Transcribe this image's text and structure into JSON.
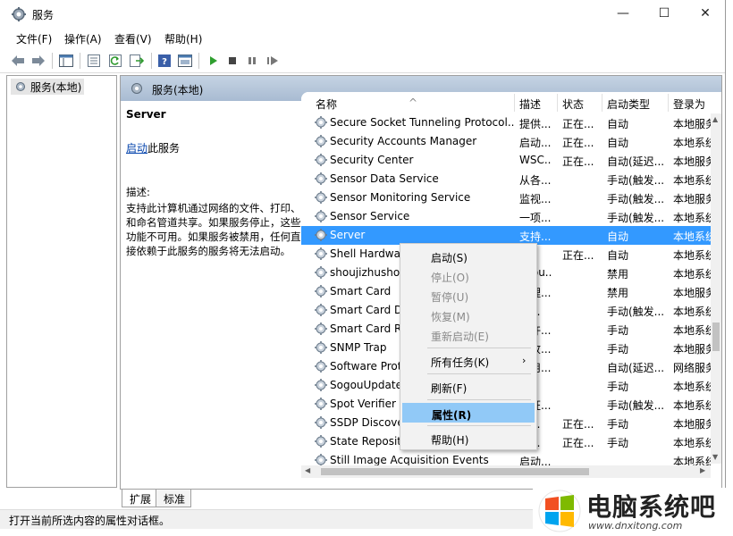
{
  "window": {
    "title": "服务",
    "minimize": "—",
    "maximize": "☐",
    "close": "✕"
  },
  "menu": [
    {
      "label": "文件(F)"
    },
    {
      "label": "操作(A)"
    },
    {
      "label": "查看(V)"
    },
    {
      "label": "帮助(H)"
    }
  ],
  "toolbar": {
    "icons": [
      "back-icon",
      "forward-icon",
      "show-tree-icon",
      "properties-icon",
      "refresh-icon",
      "export-icon",
      "help-icon",
      "console-icon",
      "start-icon",
      "stop-icon",
      "pause-icon",
      "restart-icon"
    ]
  },
  "tree": {
    "root_label": "服务(本地)"
  },
  "pane_header": {
    "title": "服务(本地)"
  },
  "description": {
    "service_name": "Server",
    "start_link": "启动",
    "start_suffix": "此服务",
    "label": "描述:",
    "text": "支持此计算机通过网络的文件、打印、和命名管道共享。如果服务停止，这些功能不可用。如果服务被禁用，任何直接依赖于此服务的服务将无法启动。"
  },
  "columns": [
    "名称",
    "描述",
    "状态",
    "启动类型",
    "登录为"
  ],
  "rows": [
    {
      "name": "Secure Socket Tunneling Protocol...",
      "desc": "提供...",
      "status": "正在...",
      "startup": "自动",
      "logon": "本地服务"
    },
    {
      "name": "Security Accounts Manager",
      "desc": "启动...",
      "status": "正在...",
      "startup": "自动",
      "logon": "本地系统"
    },
    {
      "name": "Security Center",
      "desc": "WSC...",
      "status": "正在...",
      "startup": "自动(延迟...",
      "logon": "本地服务"
    },
    {
      "name": "Sensor Data Service",
      "desc": "从各...",
      "status": "",
      "startup": "手动(触发...",
      "logon": "本地系统"
    },
    {
      "name": "Sensor Monitoring Service",
      "desc": "监视...",
      "status": "",
      "startup": "手动(触发...",
      "logon": "本地服务"
    },
    {
      "name": "Sensor Service",
      "desc": "一项...",
      "status": "",
      "startup": "手动(触发...",
      "logon": "本地系统"
    },
    {
      "name": "Server",
      "desc": "支持...",
      "status": "",
      "startup": "自动",
      "logon": "本地系统"
    },
    {
      "name": "Shell Hardware Detection",
      "desc": "",
      "status": "正在...",
      "startup": "自动",
      "logon": "本地系统"
    },
    {
      "name": "shoujizhushou",
      "desc": "shou...",
      "status": "",
      "startup": "禁用",
      "logon": "本地系统"
    },
    {
      "name": "Smart Card",
      "desc": "管理...",
      "status": "",
      "startup": "禁用",
      "logon": "本地服务"
    },
    {
      "name": "Smart Card Device Enumeration",
      "desc": "为...",
      "status": "",
      "startup": "手动(触发...",
      "logon": "本地系统"
    },
    {
      "name": "Smart Card Removal Policy",
      "desc": "允许...",
      "status": "",
      "startup": "手动",
      "logon": "本地系统"
    },
    {
      "name": "SNMP Trap",
      "desc": "接收...",
      "status": "",
      "startup": "手动",
      "logon": "本地服务"
    },
    {
      "name": "Software Protection",
      "desc": "启用...",
      "status": "",
      "startup": "自动(延迟...",
      "logon": "网络服务"
    },
    {
      "name": "SogouUpdate",
      "desc": "",
      "status": "",
      "startup": "手动",
      "logon": "本地系统"
    },
    {
      "name": "Spot Verifier",
      "desc": "验证...",
      "status": "",
      "startup": "手动(触发...",
      "logon": "本地系统"
    },
    {
      "name": "SSDP Discovery",
      "desc": "当...",
      "status": "正在...",
      "startup": "手动",
      "logon": "本地服务"
    },
    {
      "name": "State Repository Service",
      "desc": "为...",
      "status": "正在...",
      "startup": "手动",
      "logon": "本地系统"
    },
    {
      "name": "Still Image Acquisition Events",
      "desc": "启动...",
      "status": "",
      "startup": "",
      "logon": "本地系统"
    }
  ],
  "selected_row": 6,
  "context_menu": {
    "items": [
      {
        "label": "启动(S)",
        "enabled": true
      },
      {
        "label": "停止(O)",
        "enabled": false
      },
      {
        "label": "暂停(U)",
        "enabled": false
      },
      {
        "label": "恢复(M)",
        "enabled": false
      },
      {
        "label": "重新启动(E)",
        "enabled": false
      },
      {
        "label": "所有任务(K)",
        "enabled": true,
        "submenu": true
      },
      {
        "label": "刷新(F)",
        "enabled": true
      },
      {
        "label": "属性(R)",
        "enabled": true,
        "highlighted": true
      },
      {
        "label": "帮助(H)",
        "enabled": true
      }
    ],
    "submenu_arrow": "›"
  },
  "tabs": [
    {
      "label": "扩展"
    },
    {
      "label": "标准"
    }
  ],
  "statusbar": {
    "text": "打开当前所选内容的属性对话框。"
  },
  "watermark": {
    "title": "电脑系统吧",
    "url": "www.dnxitong.com"
  },
  "colors": {
    "selection": "#3399ff",
    "menu_highlight": "#91c9f7",
    "link": "#0645ad",
    "pane_header": "#b3c4d9"
  }
}
